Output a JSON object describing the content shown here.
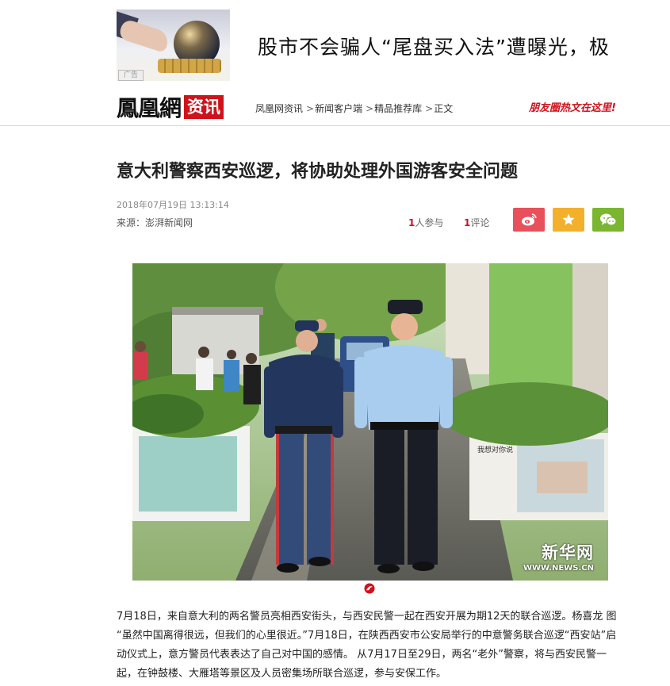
{
  "ad": {
    "badge": "广告",
    "headline": "股市不会骗人“尾盘买入法”遭曝光，极"
  },
  "header": {
    "brand_name": "鳳凰網",
    "brand_section": "资讯",
    "breadcrumbs": [
      "凤凰网资讯",
      "新闻客户端",
      "精品推荐库",
      "正文"
    ],
    "promo": "朋友圈热文在这里!"
  },
  "article": {
    "title": "意大利警察西安巡逻，将协助处理外国游客安全问题",
    "datetime": "2018年07月19日  13:13:14",
    "source_label": "来源：",
    "source_name": "澎湃新闻网",
    "participants_count": "1",
    "participants_label": "人参与",
    "comments_count": "1",
    "comments_label": "评论",
    "share_buttons": [
      {
        "icon": "weibo-icon",
        "color": "#e8505b"
      },
      {
        "icon": "star-icon",
        "color": "#f2b02b"
      },
      {
        "icon": "wechat-icon",
        "color": "#7ab62f"
      }
    ],
    "photo_watermark_cn": "新华网",
    "photo_watermark_en": "WWW.NEWS.CN",
    "planter_text": "我想对你说",
    "body": "7月18日，来自意大利的两名警员亮相西安街头，与西安民警一起在西安开展为期12天的联合巡逻。杨喜龙 图 “虽然中国离得很远，但我们的心里很近。”7月18日，在陕西西安市公安局举行的中意警务联合巡逻“西安站”启动仪式上，意方警员代表表达了自己对中国的感情。 从7月17日至29日，两名“老外”警察，将与西安民警一起，在钟鼓楼、大雁塔等景区及人员密集场所联合巡逻，参与安保工作。"
  },
  "colors": {
    "brand_red": "#d0121b",
    "text_dark": "#222222",
    "meta_gray": "#888888"
  }
}
